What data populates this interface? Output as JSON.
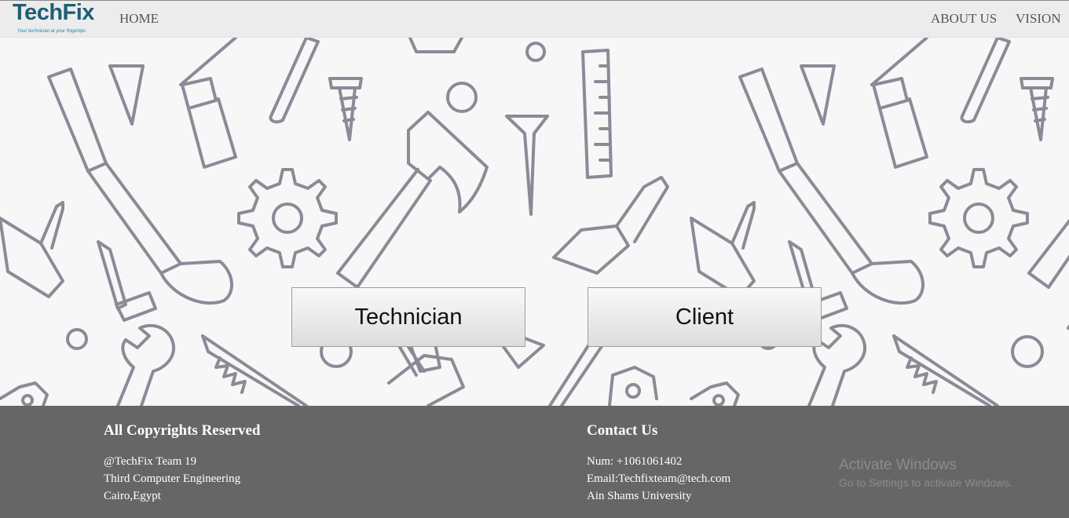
{
  "header": {
    "logo_title": "TechFix",
    "logo_tagline": "Your technician at your fingertips",
    "nav": {
      "home": "HOME",
      "about": "ABOUT US",
      "vision": "VISION"
    }
  },
  "hero": {
    "technician_button": "Technician",
    "client_button": "Client"
  },
  "footer": {
    "left": {
      "heading": "All Copyrights Reserved",
      "lines": [
        "@TechFix Team 19",
        "Third Computer Engineering",
        "Cairo,Egypt"
      ]
    },
    "right": {
      "heading": "Contact Us",
      "lines": [
        "Num: +1061061402",
        "Email:Techfixteam@tech.com",
        "Ain Shams University"
      ]
    }
  },
  "watermark": {
    "title": "Activate Windows",
    "subtitle": "Go to Settings to activate Windows."
  },
  "colors": {
    "footer_bg": "#666666",
    "logo": "#1e5e74",
    "pattern_stroke": "#8c8a96"
  }
}
